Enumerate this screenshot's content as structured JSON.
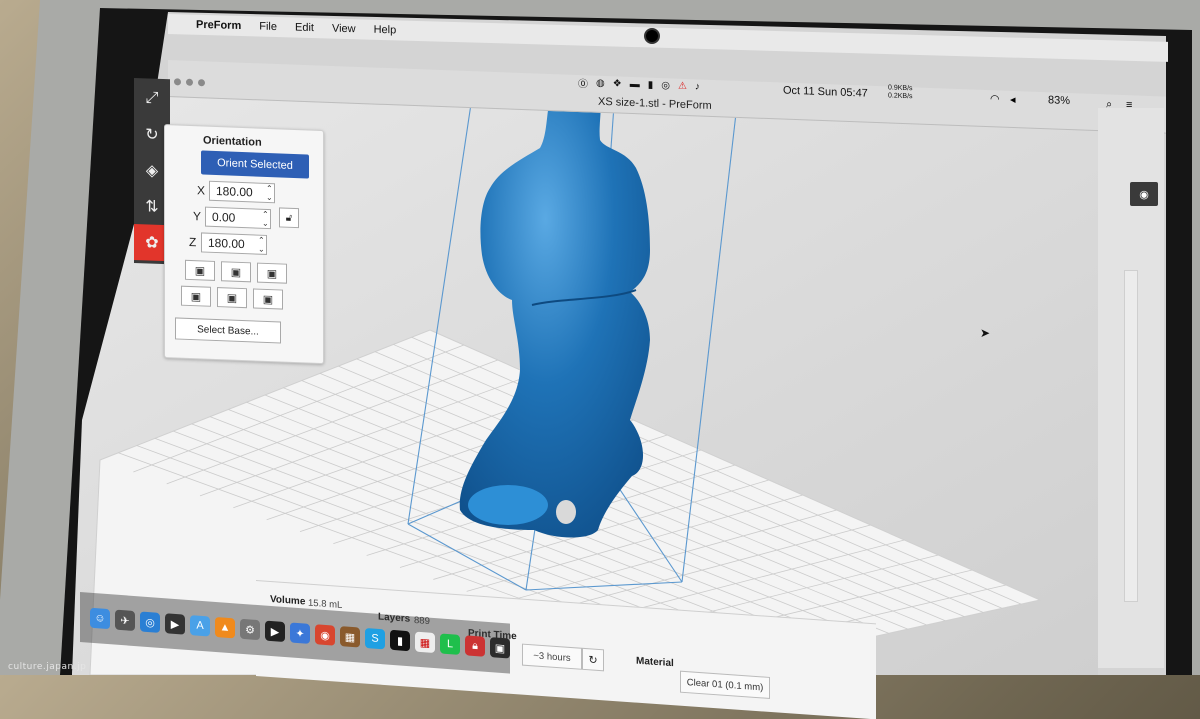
{
  "menubar": {
    "apple_icon": "apple-icon",
    "items": [
      "PreForm",
      "File",
      "Edit",
      "View",
      "Help"
    ]
  },
  "window": {
    "title": "XS size-1.stl - PreForm",
    "clock": "Oct 11 Sun 05:47",
    "net_up": "0.9KB/s",
    "net_down": "0.2KB/s",
    "battery": "83%"
  },
  "toolbar": {
    "tools": [
      {
        "name": "scale-icon",
        "glyph": "⤢"
      },
      {
        "name": "orientation-icon",
        "glyph": "↻"
      },
      {
        "name": "supports-icon",
        "glyph": "◈"
      },
      {
        "name": "layout-icon",
        "glyph": "⇅"
      },
      {
        "name": "print-icon",
        "glyph": "✿"
      }
    ],
    "active_index": 4
  },
  "orientation": {
    "title": "Orientation",
    "orient_selected": "Orient Selected",
    "x_label": "X",
    "y_label": "Y",
    "z_label": "Z",
    "x_value": "180.00",
    "y_value": "0.00",
    "z_value": "180.00",
    "select_base": "Select Base..."
  },
  "status": {
    "volume_label": "Volume",
    "volume_value": "15.8 mL",
    "layers_label": "Layers",
    "layers_value": "889",
    "print_time_label": "Print Time",
    "print_time_value": "~3 hours",
    "material_label": "Material",
    "material_value": "Clear 01 (0.1 mm)"
  },
  "watermark": "culture.japan.jp",
  "colors": {
    "model": "#1f73b7",
    "accent": "#2e5fb5",
    "tool_active": "#e2352b"
  }
}
